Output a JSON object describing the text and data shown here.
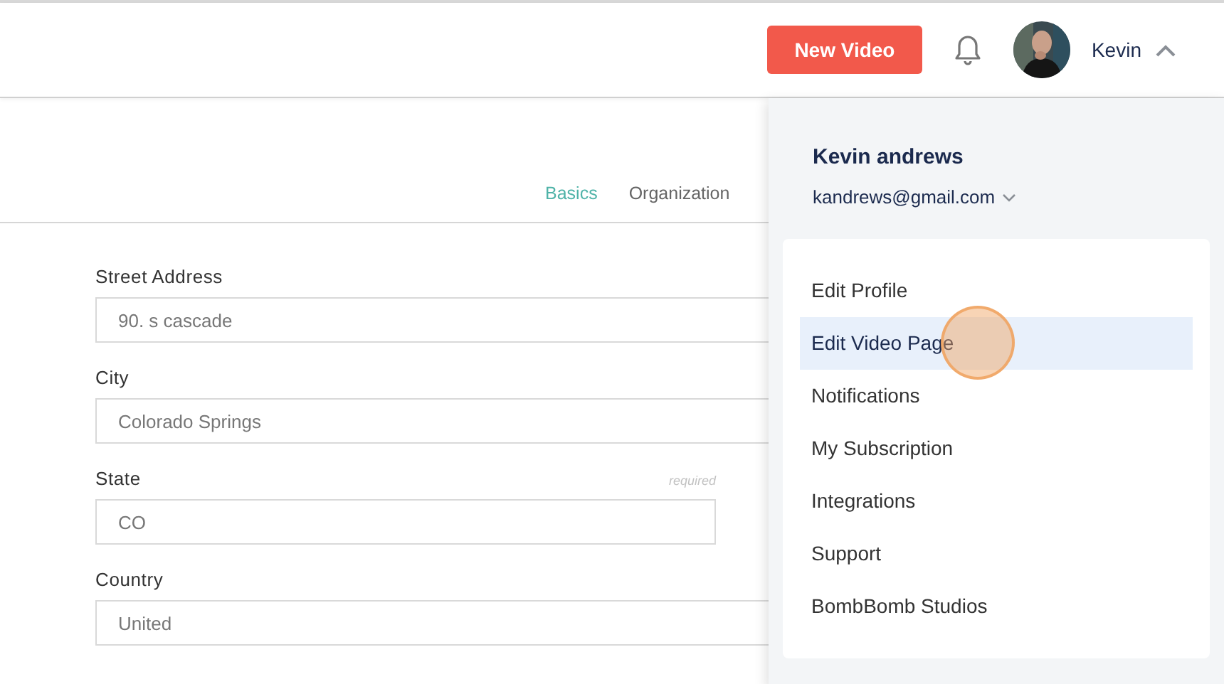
{
  "header": {
    "new_video_button": "New Video",
    "user_name": "Kevin",
    "menu_expanded": true
  },
  "tabs": [
    {
      "label": "Basics",
      "selected": true
    },
    {
      "label": "Organization",
      "selected": false
    }
  ],
  "form": {
    "fields": [
      {
        "label": "Street Address",
        "value": "90. s cascade",
        "kind": "wide"
      },
      {
        "label": "City",
        "value": "Colorado Springs",
        "kind": "wide"
      },
      {
        "label": "State",
        "value": "CO",
        "kind": "short",
        "note": "required"
      },
      {
        "label": "Country",
        "value": "United",
        "kind": "wide"
      }
    ]
  },
  "user_menu": {
    "name": "Kevin andrews",
    "email": "kandrews@gmail.com",
    "items": [
      {
        "label": "Edit Profile",
        "selected": false
      },
      {
        "label": "Edit Video Page",
        "selected": true
      },
      {
        "label": "Notifications",
        "selected": false
      },
      {
        "label": "My Subscription",
        "selected": false
      },
      {
        "label": "Integrations",
        "selected": false
      },
      {
        "label": "Support",
        "selected": false
      },
      {
        "label": "BombBomb Studios",
        "selected": false
      }
    ]
  }
}
